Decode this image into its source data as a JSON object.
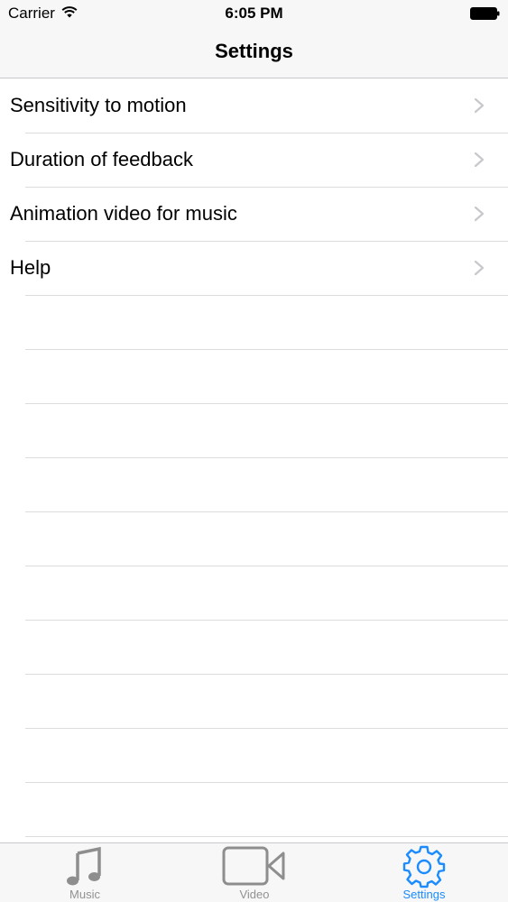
{
  "status_bar": {
    "carrier": "Carrier",
    "time": "6:05 PM",
    "wifi_icon": "wifi-icon",
    "battery_icon": "battery-icon"
  },
  "nav": {
    "title": "Settings"
  },
  "settings": {
    "items": [
      {
        "label": "Sensitivity to motion",
        "icon": "chevron-right-icon"
      },
      {
        "label": "Duration of feedback",
        "icon": "chevron-right-icon"
      },
      {
        "label": "Animation video for music",
        "icon": "chevron-right-icon"
      },
      {
        "label": "Help",
        "icon": "chevron-right-icon"
      }
    ]
  },
  "tab_bar": {
    "tabs": [
      {
        "label": "Music",
        "icon": "music-note-icon",
        "selected": false
      },
      {
        "label": "Video",
        "icon": "video-camera-icon",
        "selected": false
      },
      {
        "label": "Settings",
        "icon": "gear-icon",
        "selected": true
      }
    ]
  },
  "colors": {
    "accent": "#1a8cff",
    "inactive": "#929292",
    "separator": "#dcdcdf",
    "bar_background": "#f7f7f7"
  }
}
